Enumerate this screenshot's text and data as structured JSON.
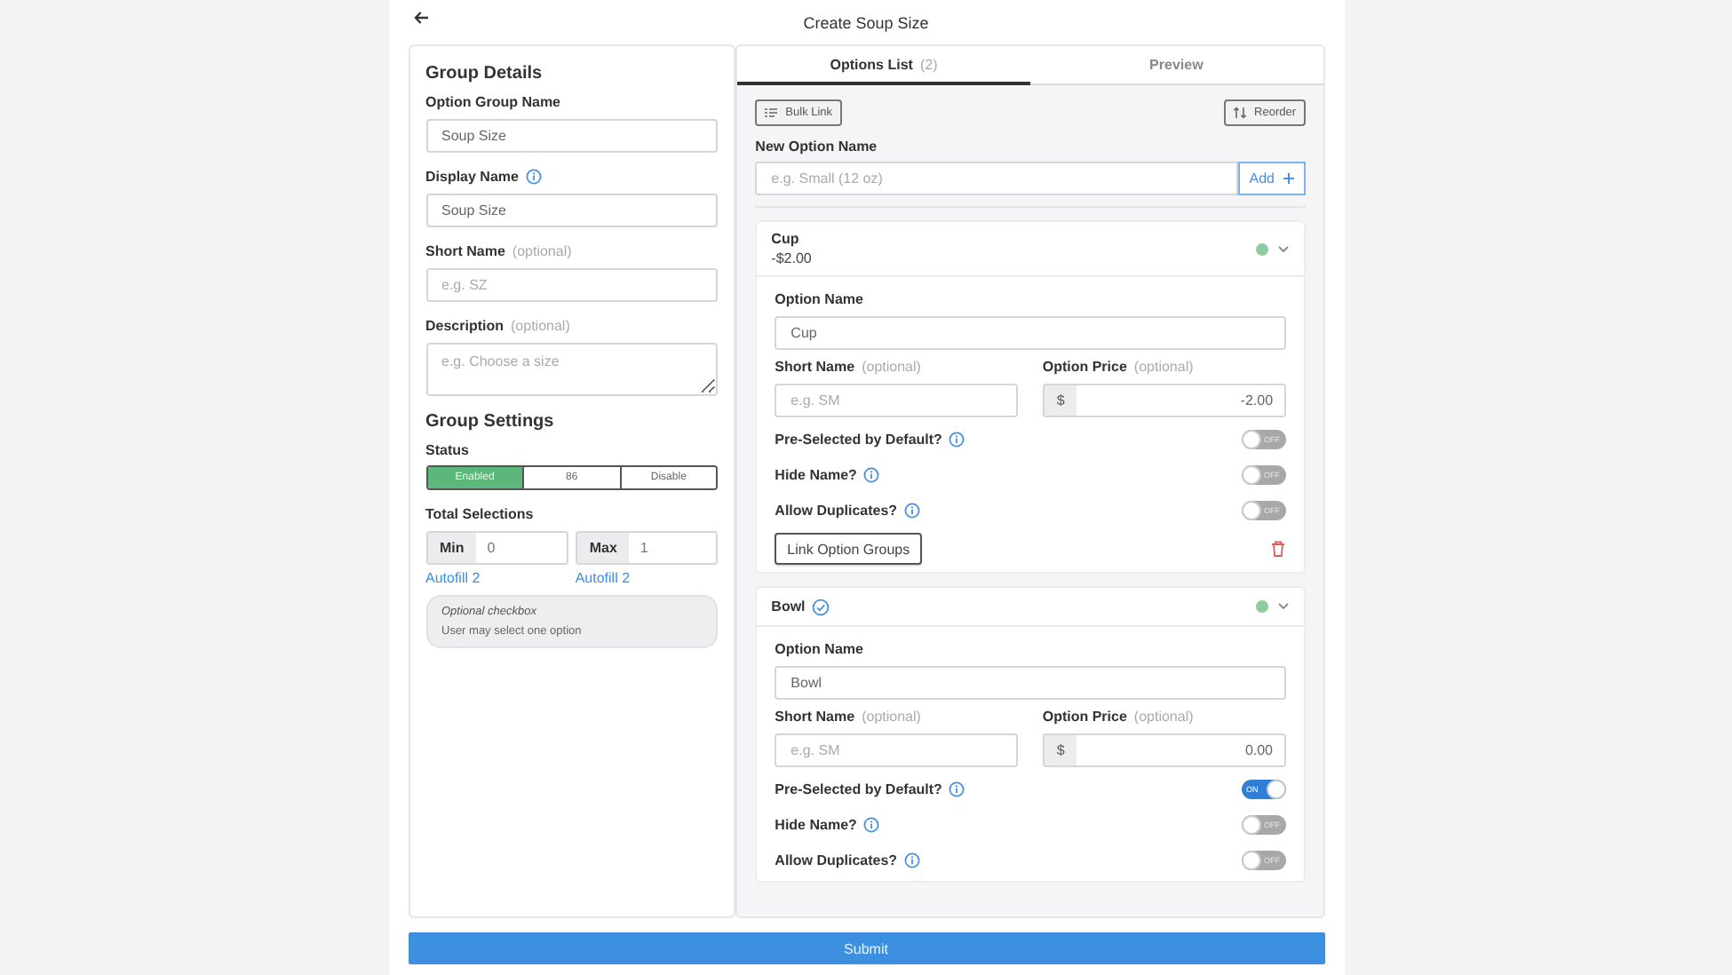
{
  "header": {
    "title": "Create Soup Size"
  },
  "group_details": {
    "heading": "Group Details",
    "fields": [
      {
        "kind": "input",
        "label": "Option Group Name",
        "value": "Soup Size"
      },
      {
        "kind": "input",
        "label": "Display Name",
        "info": true,
        "value": "Soup Size"
      },
      {
        "kind": "input",
        "label": "Short Name",
        "hint": "(optional)",
        "placeholder": "e.g. SZ"
      },
      {
        "kind": "textarea",
        "label": "Description",
        "hint": "(optional)",
        "placeholder": "e.g. Choose a size"
      }
    ]
  },
  "group_settings": {
    "heading": "Group Settings",
    "status_label": "Status",
    "status_options": [
      {
        "label": "Enabled",
        "selected": true
      },
      {
        "label": "86",
        "selected": false
      },
      {
        "label": "Disable",
        "selected": false
      }
    ],
    "total_selections_label": "Total Selections",
    "limits": [
      {
        "label": "Min",
        "value": "0",
        "autofill": "Autofill 2"
      },
      {
        "label": "Max",
        "value": "1",
        "autofill": "Autofill 2"
      }
    ],
    "note": {
      "title": "Optional checkbox",
      "text": "User may select one option"
    }
  },
  "tabs": [
    {
      "label": "Options List",
      "count": "(2)",
      "selected": true
    },
    {
      "label": "Preview",
      "selected": false
    }
  ],
  "toolbar": {
    "bulk_link": "Bulk Link",
    "reorder": "Reorder"
  },
  "new_option": {
    "label": "New Option Name",
    "placeholder": "e.g. Small (12 oz)",
    "add": "Add"
  },
  "options": [
    {
      "name": "Cup",
      "price_summary": "-$2.00",
      "preselected_badge": false,
      "color": "#8fcaa0",
      "expanded": true,
      "option_name_label": "Option Name",
      "option_name_value": "Cup",
      "short_name_label": "Short Name",
      "short_name_hint": "(optional)",
      "short_name_placeholder": "e.g. SM",
      "price_label": "Option Price",
      "price_hint": "(optional)",
      "currency": "$",
      "price_value": "-2.00",
      "toggles": [
        {
          "label": "Pre-Selected by Default?",
          "text": "OFF",
          "on": false
        },
        {
          "label": "Hide Name?",
          "text": "OFF",
          "on": false
        },
        {
          "label": "Allow Duplicates?",
          "text": "OFF",
          "on": false
        }
      ],
      "link_button": "Link Option Groups",
      "deletable": true
    },
    {
      "name": "Bowl",
      "preselected_badge": true,
      "color": "#8fcaa0",
      "expanded": true,
      "option_name_label": "Option Name",
      "option_name_value": "Bowl",
      "short_name_label": "Short Name",
      "short_name_hint": "(optional)",
      "short_name_placeholder": "e.g. SM",
      "price_label": "Option Price",
      "price_hint": "(optional)",
      "currency": "$",
      "price_value": "0.00",
      "toggles": [
        {
          "label": "Pre-Selected by Default?",
          "text": "ON",
          "on": true
        },
        {
          "label": "Hide Name?",
          "text": "OFF",
          "on": false
        },
        {
          "label": "Allow Duplicates?",
          "text": "OFF",
          "on": false
        }
      ]
    }
  ],
  "submit": "Submit"
}
